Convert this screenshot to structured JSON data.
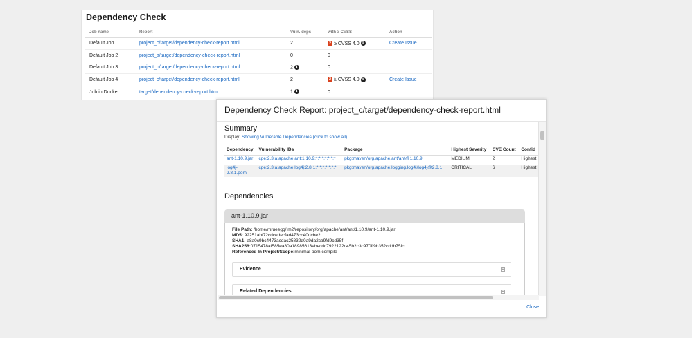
{
  "panel": {
    "title": "Dependency Check",
    "columns": [
      "Job name",
      "Report",
      "Vuln. deps",
      "with ≥ CVSS",
      "Action"
    ],
    "rows": [
      {
        "job": "Default Job",
        "report": "project_c/target/dependency-check-report.html",
        "vuln": "2",
        "vuln_info": false,
        "badge": "2",
        "cvss": "≥ CVSS 4.0",
        "cvss_info": true,
        "action": "Create Issue"
      },
      {
        "job": "Default Job 2",
        "report": "project_a/target/dependency-check-report.html",
        "vuln": "0",
        "vuln_info": false,
        "badge": "",
        "cvss": "0",
        "cvss_info": false,
        "action": ""
      },
      {
        "job": "Default Job 3",
        "report": "project_b/target/dependency-check-report.html",
        "vuln": "2",
        "vuln_info": true,
        "badge": "",
        "cvss": "0",
        "cvss_info": false,
        "action": ""
      },
      {
        "job": "Default Job 4",
        "report": "project_c/target/dependency-check-report.html",
        "vuln": "2",
        "vuln_info": false,
        "badge": "2",
        "cvss": "≥ CVSS 4.0",
        "cvss_info": true,
        "action": "Create Issue"
      },
      {
        "job": "Job in Docker",
        "report": "target/dependency-check-report.html",
        "vuln": "1",
        "vuln_info": true,
        "badge": "",
        "cvss": "0",
        "cvss_info": false,
        "action": ""
      }
    ]
  },
  "modal": {
    "title": "Dependency Check Report: project_c/target/dependency-check-report.html",
    "summary_heading": "Summary",
    "display_label": "Display:",
    "display_link": "Showing Vulnerable Dependencies (click to show all)",
    "summary_columns": [
      "Dependency",
      "Vulnerability IDs",
      "Package",
      "Highest Severity",
      "CVE Count",
      "Confid"
    ],
    "summary_rows": [
      {
        "dependency": "ant-1.10.9.jar",
        "vuln_ids": "cpe:2.3:a:apache:ant:1.10.9:*:*:*:*:*:*:*",
        "package": "pkg:maven/org.apache.ant/ant@1.10.9",
        "severity": "MEDIUM",
        "cve_count": "2",
        "confidence": "Highest"
      },
      {
        "dependency": "log4j-2.8.1.pom",
        "vuln_ids": "cpe:2.3:a:apache:log4j:2.8.1:*:*:*:*:*:*:*",
        "package": "pkg:maven/org.apache.logging.log4j/log4j@2.8.1",
        "severity": "CRITICAL",
        "cve_count": "6",
        "confidence": "Highest"
      }
    ],
    "dependencies_heading": "Dependencies",
    "dependency": {
      "name": "ant-1.10.9.jar",
      "file_path_label": "File Path:",
      "file_path": "/home/mrueegg/.m2/repository/org/apache/ant/ant/1.10.9/ant-1.10.9.jar",
      "md5_label": "MD5:",
      "md5": "92251abf72cdcedecfad473cc40dcbe2",
      "sha1_label": "SHA1:",
      "sha1": "a8a0c9bc4473acdac25832d0a9da2ca9fd9cd35f",
      "sha256_label": "SHA256:",
      "sha256": "0715478af585ea80a18985613ebecdc7922122d45b2c3c970ff9b352cddb75fc",
      "referenced_label": "Referenced In Project/Scope:",
      "referenced": "minimal-pom:compile",
      "sections": [
        "Evidence",
        "Related Dependencies"
      ]
    },
    "close_label": "Close"
  }
}
